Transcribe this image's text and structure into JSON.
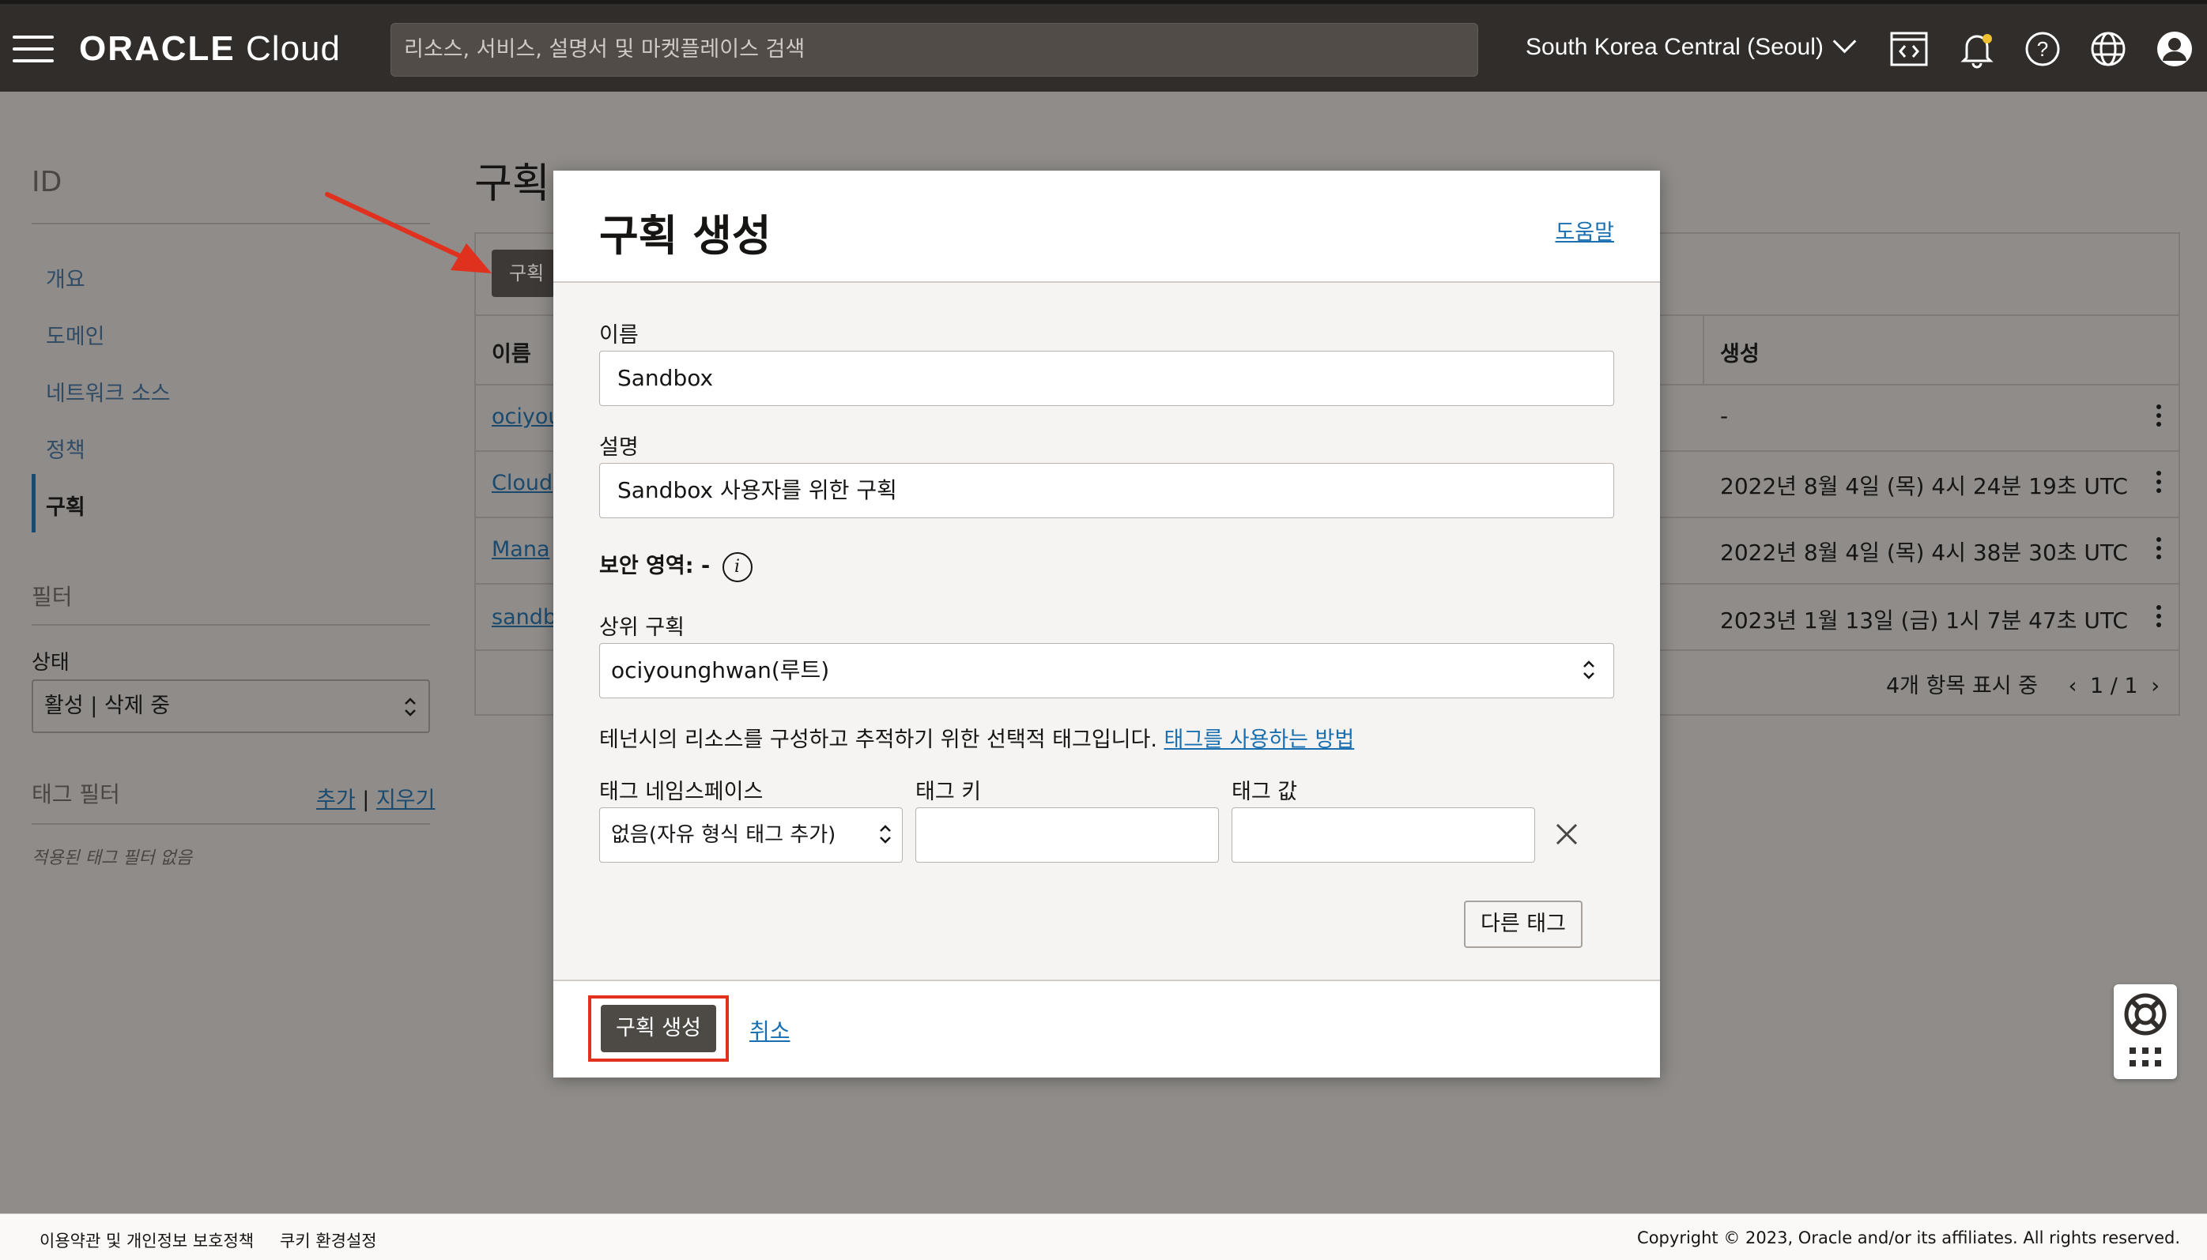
{
  "header": {
    "brand_bold": "ORACLE",
    "brand_light": "Cloud",
    "search_placeholder": "리소스, 서비스, 설명서 및 마켓플레이스 검색",
    "region": "South Korea Central (Seoul)",
    "icons": [
      "menu-icon",
      "code-editor-icon",
      "bell-icon",
      "help-icon",
      "globe-icon",
      "user-icon"
    ]
  },
  "sidebar": {
    "title": "ID",
    "items": [
      {
        "label": "개요"
      },
      {
        "label": "도메인"
      },
      {
        "label": "네트워크 소스"
      },
      {
        "label": "정책"
      },
      {
        "label": "구획"
      }
    ],
    "filter_title": "필터",
    "state_label": "상태",
    "state_value": "활성 | 삭제 중",
    "tag_filter_title": "태그 필터",
    "tag_add": "추가",
    "tag_sep": " | ",
    "tag_clear": "지우기",
    "tag_note": "적용된 태그 필터 없음"
  },
  "main": {
    "title": "구획",
    "create_button_partial": "구획",
    "columns": {
      "name": "이름",
      "created": "생성"
    },
    "rows": [
      {
        "name": "ociyou",
        "created": "-"
      },
      {
        "name": "Cloud",
        "created": "2022년 8월 4일 (목) 4시 24분 19초 UTC"
      },
      {
        "name": "Mana",
        "created": "2022년 8월 4일 (목) 4시 38분 30초 UTC"
      },
      {
        "name": "sandb",
        "created": "2023년 1월 13일 (금) 1시 7분 47초 UTC"
      }
    ],
    "pager_count": "4개 항목 표시 중",
    "pager_page": "1 / 1"
  },
  "modal": {
    "title": "구획 생성",
    "help_link": "도움말",
    "name_label": "이름",
    "name_value": "Sandbox",
    "desc_label": "설명",
    "desc_value": "Sandbox 사용자를 위한 구획",
    "security_zone_label": "보안 영역: -",
    "parent_label": "상위 구획",
    "parent_value": "ociyounghwan(루트)",
    "tag_help_text": "테넌시의 리소스를 구성하고 추적하기 위한 선택적 태그입니다.",
    "tag_help_link": "태그를 사용하는 방법",
    "tag_ns_label": "태그 네임스페이스",
    "tag_ns_value": "없음(자유 형식 태그 추가)",
    "tag_key_label": "태그 키",
    "tag_value_label": "태그 값",
    "tag_key_value": "",
    "tag_value_value": "",
    "other_tag_button": "다른 태그",
    "create_button": "구획 생성",
    "cancel_link": "취소"
  },
  "footer": {
    "terms": "이용약관 및 개인정보 보호정책",
    "cookies": "쿠키 환경설정",
    "copyright": "Copyright © 2023, Oracle and/or its affiliates. All rights reserved."
  },
  "colors": {
    "topbar": "#312d2a",
    "overlay": "#8f8c89",
    "link": "#1a6fb0",
    "highlight": "#e0301e",
    "primary_button": "#4d4945"
  }
}
